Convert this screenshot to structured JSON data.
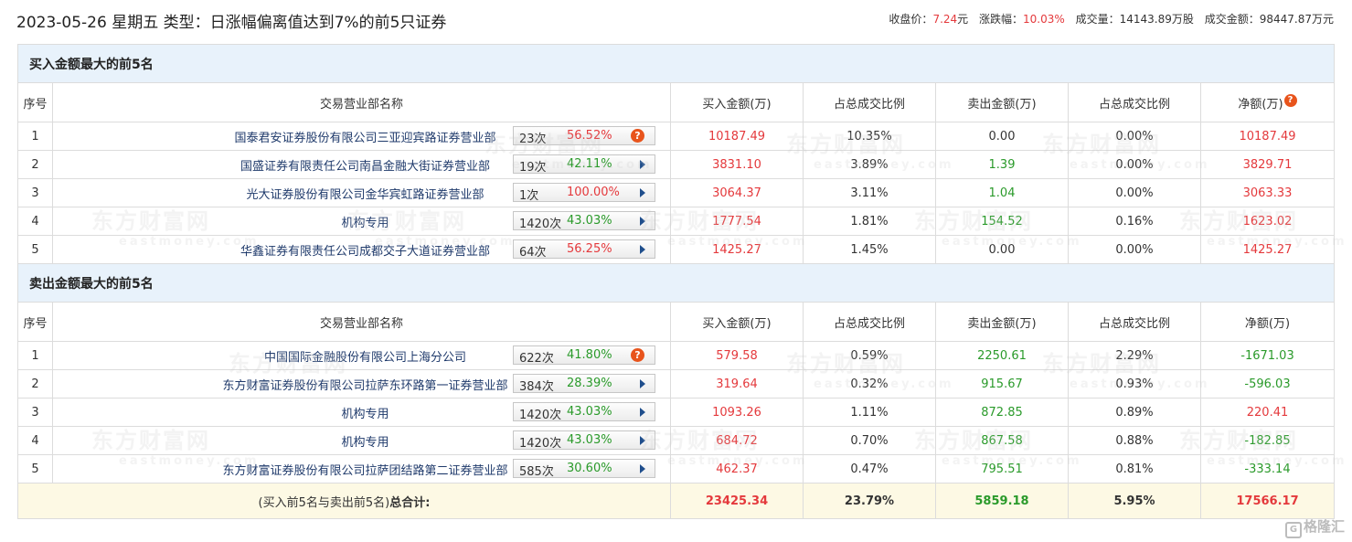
{
  "header": {
    "title": "2023-05-26 星期五 类型：日涨幅偏离值达到7%的前5只证券",
    "close_label": "收盘价：",
    "close_value": "7.24",
    "close_unit": "元",
    "change_label": "涨跌幅：",
    "change_value": "10.03%",
    "volume_label": "成交量：",
    "volume_value": "14143.89万股",
    "amount_label": "成交金额：",
    "amount_value": "98447.87万元"
  },
  "columns": [
    "序号",
    "交易营业部名称",
    "买入金额(万)",
    "占总成交比例",
    "卖出金额(万)",
    "占总成交比例",
    "净额(万)"
  ],
  "buy_section": {
    "title": "买入金额最大的前5名",
    "rows": [
      {
        "idx": "1",
        "name": "国泰君安证券股份有限公司三亚迎宾路证券营业部",
        "count": "23次",
        "pct": "56.52%",
        "pct_color": "red",
        "icon": "question-icon",
        "buy": "10187.49",
        "buy_ratio": "10.35%",
        "sell": "0.00",
        "sell_ratio": "0.00%",
        "net": "10187.49"
      },
      {
        "idx": "2",
        "name": "国盛证券有限责任公司南昌金融大街证券营业部",
        "count": "19次",
        "pct": "42.11%",
        "pct_color": "green",
        "icon": "arrow-right-icon",
        "buy": "3831.10",
        "buy_ratio": "3.89%",
        "sell": "1.39",
        "sell_ratio": "0.00%",
        "net": "3829.71"
      },
      {
        "idx": "3",
        "name": "光大证券股份有限公司金华宾虹路证券营业部",
        "count": "1次",
        "pct": "100.00%",
        "pct_color": "red",
        "icon": "arrow-right-icon",
        "buy": "3064.37",
        "buy_ratio": "3.11%",
        "sell": "1.04",
        "sell_ratio": "0.00%",
        "net": "3063.33"
      },
      {
        "idx": "4",
        "name": "机构专用",
        "count": "1420次",
        "pct": "43.03%",
        "pct_color": "green",
        "icon": "arrow-right-icon",
        "buy": "1777.54",
        "buy_ratio": "1.81%",
        "sell": "154.52",
        "sell_ratio": "0.16%",
        "net": "1623.02"
      },
      {
        "idx": "5",
        "name": "华鑫证券有限责任公司成都交子大道证券营业部",
        "count": "64次",
        "pct": "56.25%",
        "pct_color": "red",
        "icon": "arrow-right-icon",
        "buy": "1425.27",
        "buy_ratio": "1.45%",
        "sell": "0.00",
        "sell_ratio": "0.00%",
        "net": "1425.27"
      }
    ]
  },
  "sell_section": {
    "title": "卖出金额最大的前5名",
    "rows": [
      {
        "idx": "1",
        "name": "中国国际金融股份有限公司上海分公司",
        "count": "622次",
        "pct": "41.80%",
        "pct_color": "green",
        "icon": "question-icon",
        "buy": "579.58",
        "buy_ratio": "0.59%",
        "sell": "2250.61",
        "sell_ratio": "2.29%",
        "net": "-1671.03"
      },
      {
        "idx": "2",
        "name": "东方财富证券股份有限公司拉萨东环路第一证券营业部",
        "count": "384次",
        "pct": "28.39%",
        "pct_color": "green",
        "icon": "arrow-right-icon",
        "buy": "319.64",
        "buy_ratio": "0.32%",
        "sell": "915.67",
        "sell_ratio": "0.93%",
        "net": "-596.03"
      },
      {
        "idx": "3",
        "name": "机构专用",
        "count": "1420次",
        "pct": "43.03%",
        "pct_color": "green",
        "icon": "arrow-right-icon",
        "buy": "1093.26",
        "buy_ratio": "1.11%",
        "sell": "872.85",
        "sell_ratio": "0.89%",
        "net": "220.41"
      },
      {
        "idx": "4",
        "name": "机构专用",
        "count": "1420次",
        "pct": "43.03%",
        "pct_color": "green",
        "icon": "arrow-right-icon",
        "buy": "684.72",
        "buy_ratio": "0.70%",
        "sell": "867.58",
        "sell_ratio": "0.88%",
        "net": "-182.85"
      },
      {
        "idx": "5",
        "name": "东方财富证券股份有限公司拉萨团结路第二证券营业部",
        "count": "585次",
        "pct": "30.60%",
        "pct_color": "green",
        "icon": "arrow-right-icon",
        "buy": "462.37",
        "buy_ratio": "0.47%",
        "sell": "795.51",
        "sell_ratio": "0.81%",
        "net": "-333.14"
      }
    ]
  },
  "total": {
    "label_prefix": "(买入前5名与卖出前5名)",
    "label_bold": "总合计:",
    "buy": "23425.34",
    "buy_ratio": "23.79%",
    "sell": "5859.18",
    "sell_ratio": "5.95%",
    "net": "17566.17"
  },
  "watermark": {
    "cn": "东方财富网",
    "en": "eastmoney.com"
  },
  "corner_logo": "格隆汇",
  "colors": {
    "up": "#e4393c",
    "down": "#2a9a2a",
    "section_bg": "#e8f2fb",
    "total_bg": "#fdf9e4",
    "name_text": "#1f3a6b"
  }
}
